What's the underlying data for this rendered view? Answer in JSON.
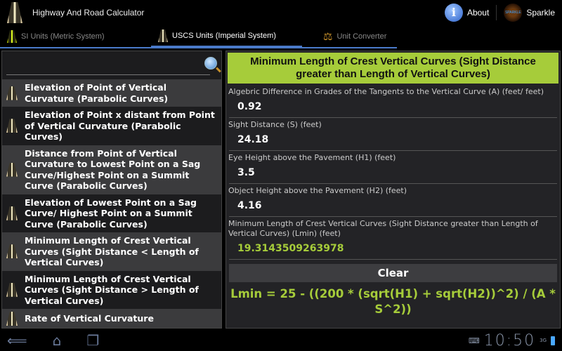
{
  "app": {
    "title": "Highway And Road Calculator",
    "about": "About",
    "sparkle": "Sparkle",
    "sparkle_logo": "SPARKLE"
  },
  "tabs": [
    {
      "label": "SI Units (Metric System)"
    },
    {
      "label": "USCS Units (Imperial System)"
    },
    {
      "label": "Unit Converter"
    }
  ],
  "list": [
    "Elevation of Point of Vertical Curvature (Parabolic Curves)",
    "Elevation of Point x distant from Point of Vertical Curvature (Parabolic Curves)",
    "Distance from Point of Vertical Curvature to Lowest Point on a Sag Curve/Highest Point on a Summit Curve (Parabolic Curves)",
    "Elevation of Lowest Point on a Sag Curve/ Highest Point on a Summit Curve (Parabolic Curves)",
    "Minimum Length of Crest Vertical Curves (Sight Distance < Length of Vertical Curves)",
    "Minimum Length of Crest Vertical Curves (Sight Distance > Length of Vertical Curves)",
    "Rate of Vertical Curvature"
  ],
  "calc": {
    "title": "Minimum Length of Crest Vertical Curves (Sight Distance greater than Length of Vertical Curves)",
    "fields": [
      {
        "label": "Algebric Difference in Grades of the Tangents to the Vertical Curve (A) (feet/ feet)",
        "value": "0.92"
      },
      {
        "label": "Sight Distance (S) (feet)",
        "value": "24.18"
      },
      {
        "label": "Eye Height above the Pavement (H1) (feet)",
        "value": "3.5"
      },
      {
        "label": "Object Height above the Pavement (H2) (feet)",
        "value": "4.16"
      }
    ],
    "result_label": "Minimum Length of Crest Vertical Curves (Sight Distance greater than Length of Vertical Curves) (Lmin) (feet)",
    "result": "19.3143509263978",
    "clear": "Clear",
    "formula": "Lmin = 25 - ((200 * (sqrt(H1) + sqrt(H2))^2) / (A * S^2))"
  },
  "status": {
    "time": "10:50",
    "network": "3G"
  }
}
